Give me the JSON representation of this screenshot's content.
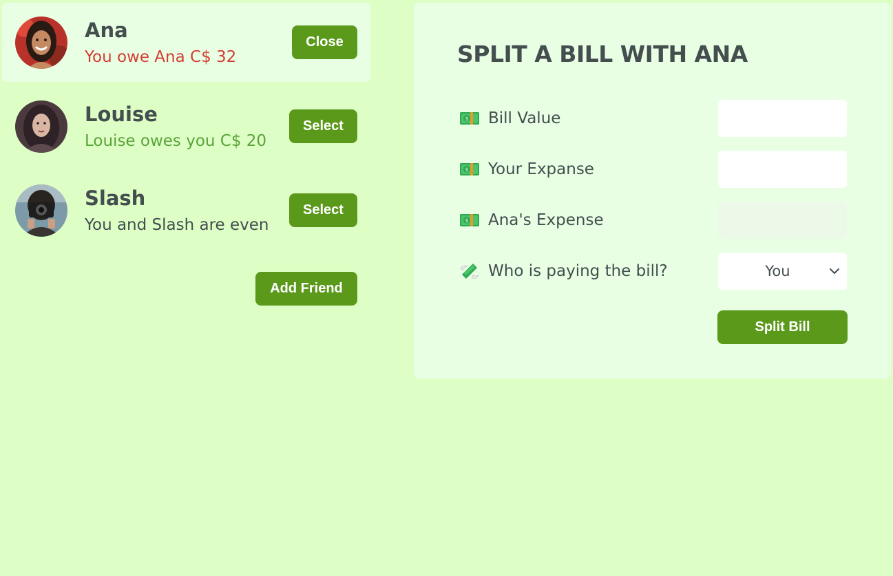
{
  "friends": [
    {
      "name": "Ana",
      "status": "You owe Ana C$ 32",
      "status_tone": "negative",
      "button": "Close",
      "selected": true
    },
    {
      "name": "Louise",
      "status": "Louise owes you C$ 20",
      "status_tone": "positive",
      "button": "Select",
      "selected": false
    },
    {
      "name": "Slash",
      "status": "You and Slash are even",
      "status_tone": "neutral",
      "button": "Select",
      "selected": false
    }
  ],
  "add_friend_label": "Add Friend",
  "split": {
    "title": "SPLIT A BILL WITH ANA",
    "bill_value_label": "Bill Value",
    "bill_value": "",
    "your_expense_label": "Your Expanse",
    "your_expense": "",
    "friend_expense_label": "Ana's Expense",
    "friend_expense": "",
    "payer_label": "Who is paying the bill?",
    "payer_value": "You",
    "payer_options": [
      "You"
    ],
    "submit_label": "Split Bill"
  },
  "icons": {
    "money": "dollar-banknote-icon",
    "money_wings": "money-with-wings-icon",
    "chevron": "chevron-down-icon"
  },
  "colors": {
    "background": "#ddffc6",
    "panel": "#e8ffe4",
    "button": "#5b991b",
    "negative": "#d43d35",
    "positive": "#5ca33a",
    "text": "#444e4f"
  }
}
